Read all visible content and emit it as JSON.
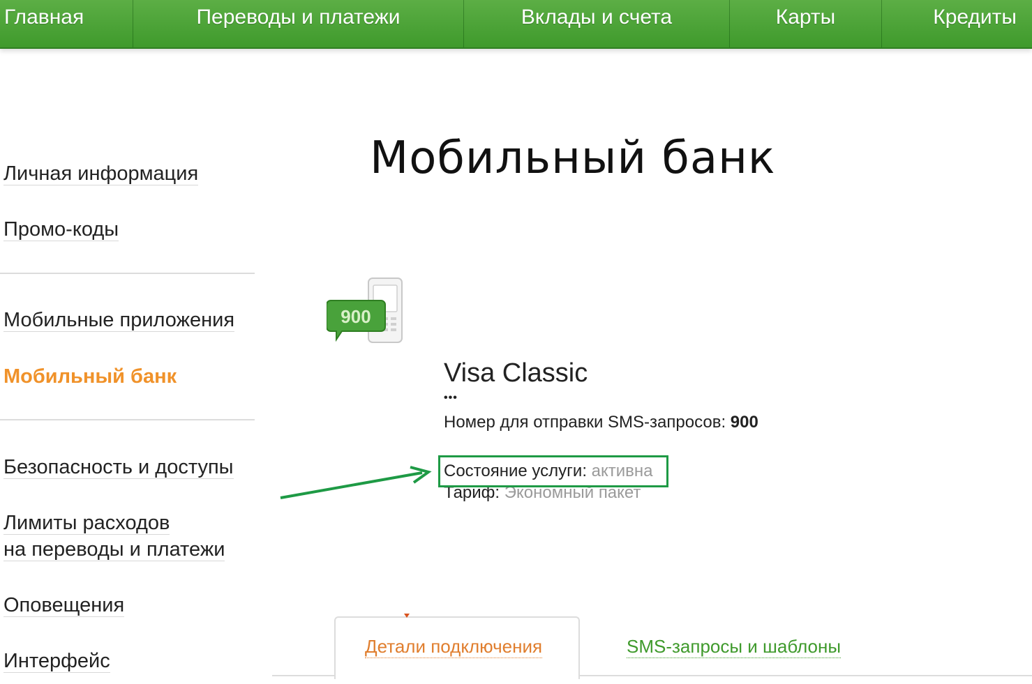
{
  "topnav": {
    "items": [
      {
        "label": "Главная"
      },
      {
        "label": "Переводы и платежи"
      },
      {
        "label": "Вклады и счета"
      },
      {
        "label": "Карты"
      },
      {
        "label": "Кредиты"
      }
    ]
  },
  "sidebar": {
    "items": [
      {
        "label": "Личная информация"
      },
      {
        "label": "Промо-коды"
      },
      {
        "label": "Мобильные приложения"
      },
      {
        "label": "Мобильный банк",
        "active": true
      },
      {
        "label": "Безопасность и доступы"
      },
      {
        "label": "Лимиты расходов"
      },
      {
        "label": "на переводы и платежи"
      },
      {
        "label": "Оповещения"
      },
      {
        "label": "Интерфейс"
      }
    ]
  },
  "main": {
    "title": "Мобильный банк",
    "icon_text": "900",
    "card_name": "Visa Classic",
    "card_mask": "•••",
    "sms_label": "Номер для отправки SMS-запросов: ",
    "sms_number": "900",
    "status_label": "Состояние услуги: ",
    "status_value": "активна",
    "tariff_label": "Тариф: ",
    "tariff_value": "Экономный пакет"
  },
  "tabs": [
    {
      "label": "Детали подключения",
      "active": true
    },
    {
      "label": "SMS-запросы и шаблоны",
      "active": false
    }
  ],
  "colors": {
    "nav_green": "#4ea63a",
    "active_orange": "#f0922a",
    "highlight_green": "#1e9a45"
  }
}
